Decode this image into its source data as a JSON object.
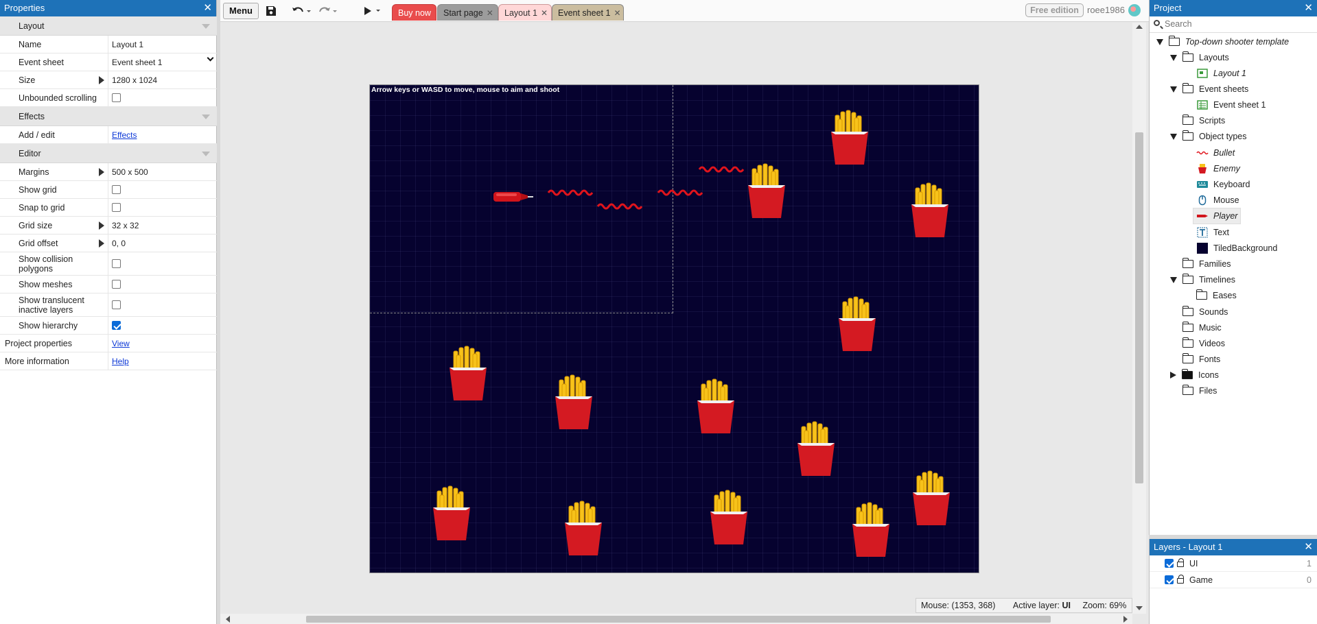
{
  "properties": {
    "title": "Properties",
    "sections": {
      "layout": "Layout",
      "effects": "Effects",
      "editor": "Editor"
    },
    "rows": {
      "name": {
        "label": "Name",
        "value": "Layout 1"
      },
      "event_sheet": {
        "label": "Event sheet",
        "value": "Event sheet 1"
      },
      "size": {
        "label": "Size",
        "value": "1280 x 1024"
      },
      "unbounded": {
        "label": "Unbounded scrolling",
        "checked": false
      },
      "add_edit": {
        "label": "Add / edit",
        "link": "Effects"
      },
      "margins": {
        "label": "Margins",
        "value": "500 x 500"
      },
      "show_grid": {
        "label": "Show grid",
        "checked": false
      },
      "snap": {
        "label": "Snap to grid",
        "checked": false
      },
      "grid_size": {
        "label": "Grid size",
        "value": "32 x 32"
      },
      "grid_offset": {
        "label": "Grid offset",
        "value": "0, 0"
      },
      "collision": {
        "label": "Show collision polygons",
        "checked": false
      },
      "meshes": {
        "label": "Show meshes",
        "checked": false
      },
      "translucent": {
        "label": "Show translucent inactive layers",
        "checked": false
      },
      "hierarchy": {
        "label": "Show hierarchy",
        "checked": true
      },
      "project_props": {
        "label": "Project properties",
        "link": "View"
      },
      "more_info": {
        "label": "More information",
        "link": "Help"
      }
    }
  },
  "toolbar": {
    "menu": "Menu",
    "tabs": {
      "buy": "Buy now",
      "start": "Start page",
      "layout": "Layout 1",
      "events": "Event sheet 1"
    },
    "free_edition": "Free edition",
    "user": "roee1986"
  },
  "layout_view": {
    "hint": "Arrow keys or WASD to move, mouse to aim and shoot",
    "status": {
      "mouse": "Mouse: (1353, 368)",
      "active_layer_label": "Active layer:",
      "active_layer": "UI",
      "zoom": "Zoom: 69%"
    }
  },
  "project": {
    "title": "Project",
    "search_placeholder": "Search",
    "root": "Top-down shooter template",
    "layouts": "Layouts",
    "layout1": "Layout 1",
    "event_sheets": "Event sheets",
    "event_sheet1": "Event sheet 1",
    "scripts": "Scripts",
    "object_types": "Object types",
    "objects": {
      "bullet": "Bullet",
      "enemy": "Enemy",
      "keyboard": "Keyboard",
      "mouse": "Mouse",
      "player": "Player",
      "text": "Text",
      "tiled": "TiledBackground"
    },
    "families": "Families",
    "timelines": "Timelines",
    "eases": "Eases",
    "sounds": "Sounds",
    "music": "Music",
    "videos": "Videos",
    "fonts": "Fonts",
    "icons": "Icons",
    "files": "Files"
  },
  "layers": {
    "title": "Layers - Layout 1",
    "items": [
      {
        "name": "UI",
        "index": "1",
        "visible": true
      },
      {
        "name": "Game",
        "index": "0",
        "visible": true
      }
    ]
  },
  "colors": {
    "panel_header": "#1e72b8",
    "canvas_bg": "#06022f",
    "buy_tab": "#e94c4c",
    "checkbox_on": "#0b6bd8"
  }
}
